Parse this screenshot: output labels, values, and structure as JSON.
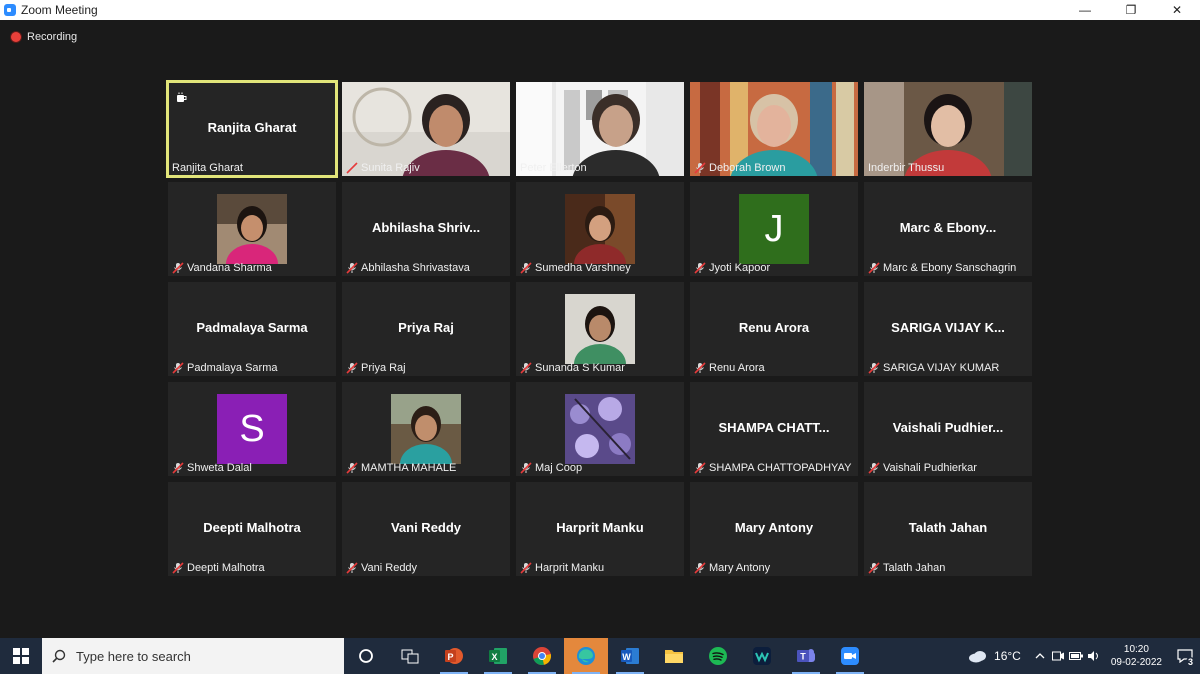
{
  "window": {
    "title": "Zoom Meeting",
    "controls": {
      "minimize": "—",
      "maximize": "❐",
      "close": "✕"
    }
  },
  "recording": {
    "label": "Recording",
    "color": "#e8403a"
  },
  "participants": [
    {
      "name": "Ranjita Gharat",
      "display": "Ranjita Gharat",
      "type": "name",
      "active": true,
      "muted": false,
      "coffee_icon": true
    },
    {
      "name": "Sunita Rajiv",
      "type": "video",
      "muted": true
    },
    {
      "name": "Peter Ellerton",
      "type": "video",
      "muted": false
    },
    {
      "name": "Deborah Brown",
      "type": "video",
      "muted": true
    },
    {
      "name": "Inderbir Thussu",
      "type": "video",
      "muted": false
    },
    {
      "name": "Vandana Sharma",
      "type": "photo",
      "muted": true
    },
    {
      "name": "Abhilasha Shrivastava",
      "display": "Abhilasha  Shriv...",
      "type": "name",
      "muted": true
    },
    {
      "name": "Sumedha Varshney",
      "type": "photo",
      "muted": true
    },
    {
      "name": "Jyoti Kapoor",
      "type": "initial",
      "initial": "J",
      "color": "#2f6e1c",
      "muted": true
    },
    {
      "name": "Marc & Ebony  Sanschagrin",
      "display": "Marc  &  Ebony...",
      "type": "name",
      "muted": true
    },
    {
      "name": "Padmalaya Sarma",
      "display": "Padmalaya Sarma",
      "type": "name",
      "muted": true
    },
    {
      "name": "Priya Raj",
      "display": "Priya Raj",
      "type": "name",
      "muted": true
    },
    {
      "name": "Sunanda S Kumar",
      "type": "photo",
      "muted": true
    },
    {
      "name": "Renu Arora",
      "display": "Renu Arora",
      "type": "name",
      "muted": true
    },
    {
      "name": "SARIGA VIJAY KUMAR",
      "display": "SARIGA  VIJAY  K...",
      "type": "name",
      "muted": true
    },
    {
      "name": "Shweta Dalal",
      "type": "initial",
      "initial": "S",
      "color": "#8a1fb5",
      "muted": true
    },
    {
      "name": "MAMTHA MAHALE",
      "type": "photo",
      "muted": true
    },
    {
      "name": "Maj Coop",
      "type": "photo",
      "muted": true
    },
    {
      "name": "SHAMPA CHATTOPADHYAY",
      "display": "SHAMPA  CHATT...",
      "type": "name",
      "muted": true
    },
    {
      "name": "Vaishali Pudhierkar",
      "display": "Vaishali  Pudhier...",
      "type": "name",
      "muted": true
    },
    {
      "name": "Deepti Malhotra",
      "display": "Deepti Malhotra",
      "type": "name",
      "muted": true
    },
    {
      "name": "Vani Reddy",
      "display": "Vani Reddy",
      "type": "name",
      "muted": true
    },
    {
      "name": "Harprit Manku",
      "display": "Harprit Manku",
      "type": "name",
      "muted": true
    },
    {
      "name": "Mary Antony",
      "display": "Mary Antony",
      "type": "name",
      "muted": true
    },
    {
      "name": "Talath Jahan",
      "display": "Talath Jahan",
      "type": "name",
      "muted": true
    }
  ],
  "taskbar": {
    "search_placeholder": "Type here to search",
    "apps": [
      {
        "icon": "cortana-icon",
        "running": false
      },
      {
        "icon": "task-view-icon",
        "running": false
      },
      {
        "icon": "powerpoint-icon",
        "running": true
      },
      {
        "icon": "excel-icon",
        "running": true
      },
      {
        "icon": "chrome-icon",
        "running": true
      },
      {
        "icon": "edge-icon",
        "running": true,
        "focused": true
      },
      {
        "icon": "word-icon",
        "running": true
      },
      {
        "icon": "file-explorer-icon",
        "running": false
      },
      {
        "icon": "spotify-icon",
        "running": false
      },
      {
        "icon": "webex-icon",
        "running": false
      },
      {
        "icon": "teams-icon",
        "running": true
      },
      {
        "icon": "zoom-icon",
        "running": true
      }
    ],
    "temperature": "16°C",
    "time": "10:20",
    "date": "09-02-2022",
    "notifications": "3"
  }
}
